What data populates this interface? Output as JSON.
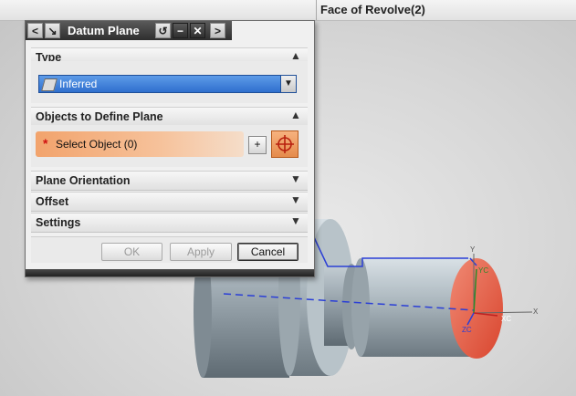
{
  "viewport": {
    "face_label": "Face of Revolve(2)",
    "axis_labels": {
      "y": "Y",
      "yc": "YC",
      "zc": "ZC",
      "xc": "XC",
      "x": "X"
    }
  },
  "dialog": {
    "title": "Datum Plane",
    "title_buttons": {
      "back": "<",
      "pin": "↘",
      "reset": "↺",
      "minimize": "−",
      "close": "✕",
      "forward": ">"
    },
    "sections": {
      "type": {
        "label": "Type",
        "expanded": true,
        "selected_value": "Inferred"
      },
      "objects": {
        "label": "Objects to Define Plane",
        "expanded": true,
        "select_required_marker": "*",
        "select_label": "Select Object (0)"
      },
      "plane_orientation": {
        "label": "Plane Orientation",
        "expanded": false
      },
      "offset": {
        "label": "Offset",
        "expanded": false
      },
      "settings": {
        "label": "Settings",
        "expanded": false
      }
    },
    "buttons": {
      "ok": "OK",
      "apply": "Apply",
      "cancel": "Cancel"
    }
  },
  "colors": {
    "select_highlight": "#f2a36c",
    "dropdown_selected": "#2f6fce",
    "face_highlight": "#e8604c",
    "wire_blue": "#2b3fd6"
  }
}
